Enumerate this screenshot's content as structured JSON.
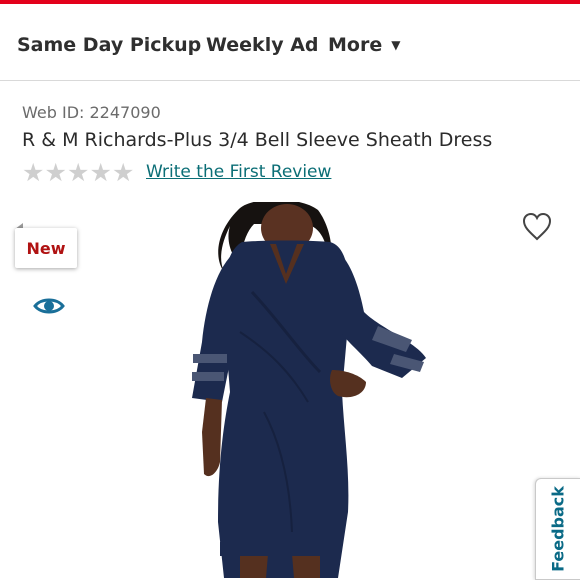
{
  "nav": {
    "items": [
      {
        "label": "Same Day Pickup"
      },
      {
        "label": "Weekly Ad"
      },
      {
        "label": "More"
      }
    ]
  },
  "product": {
    "web_id": "Web ID: 2247090",
    "title": "R & M Richards-Plus 3/4 Bell Sleeve Sheath Dress",
    "rating": 0,
    "rating_max": 5,
    "review_link": "Write the First Review",
    "badge": "New"
  },
  "feedback_label": "Feedback",
  "colors": {
    "brand_red": "#e3001b",
    "badge_text": "#b01212",
    "link_teal": "#0b6e76",
    "eye_icon": "#1a6f99",
    "feedback_text": "#0a6a86",
    "dress_navy": "#1c2a4e"
  },
  "icons": [
    "chevron-down-icon",
    "star-icon",
    "eye-icon",
    "heart-icon"
  ]
}
